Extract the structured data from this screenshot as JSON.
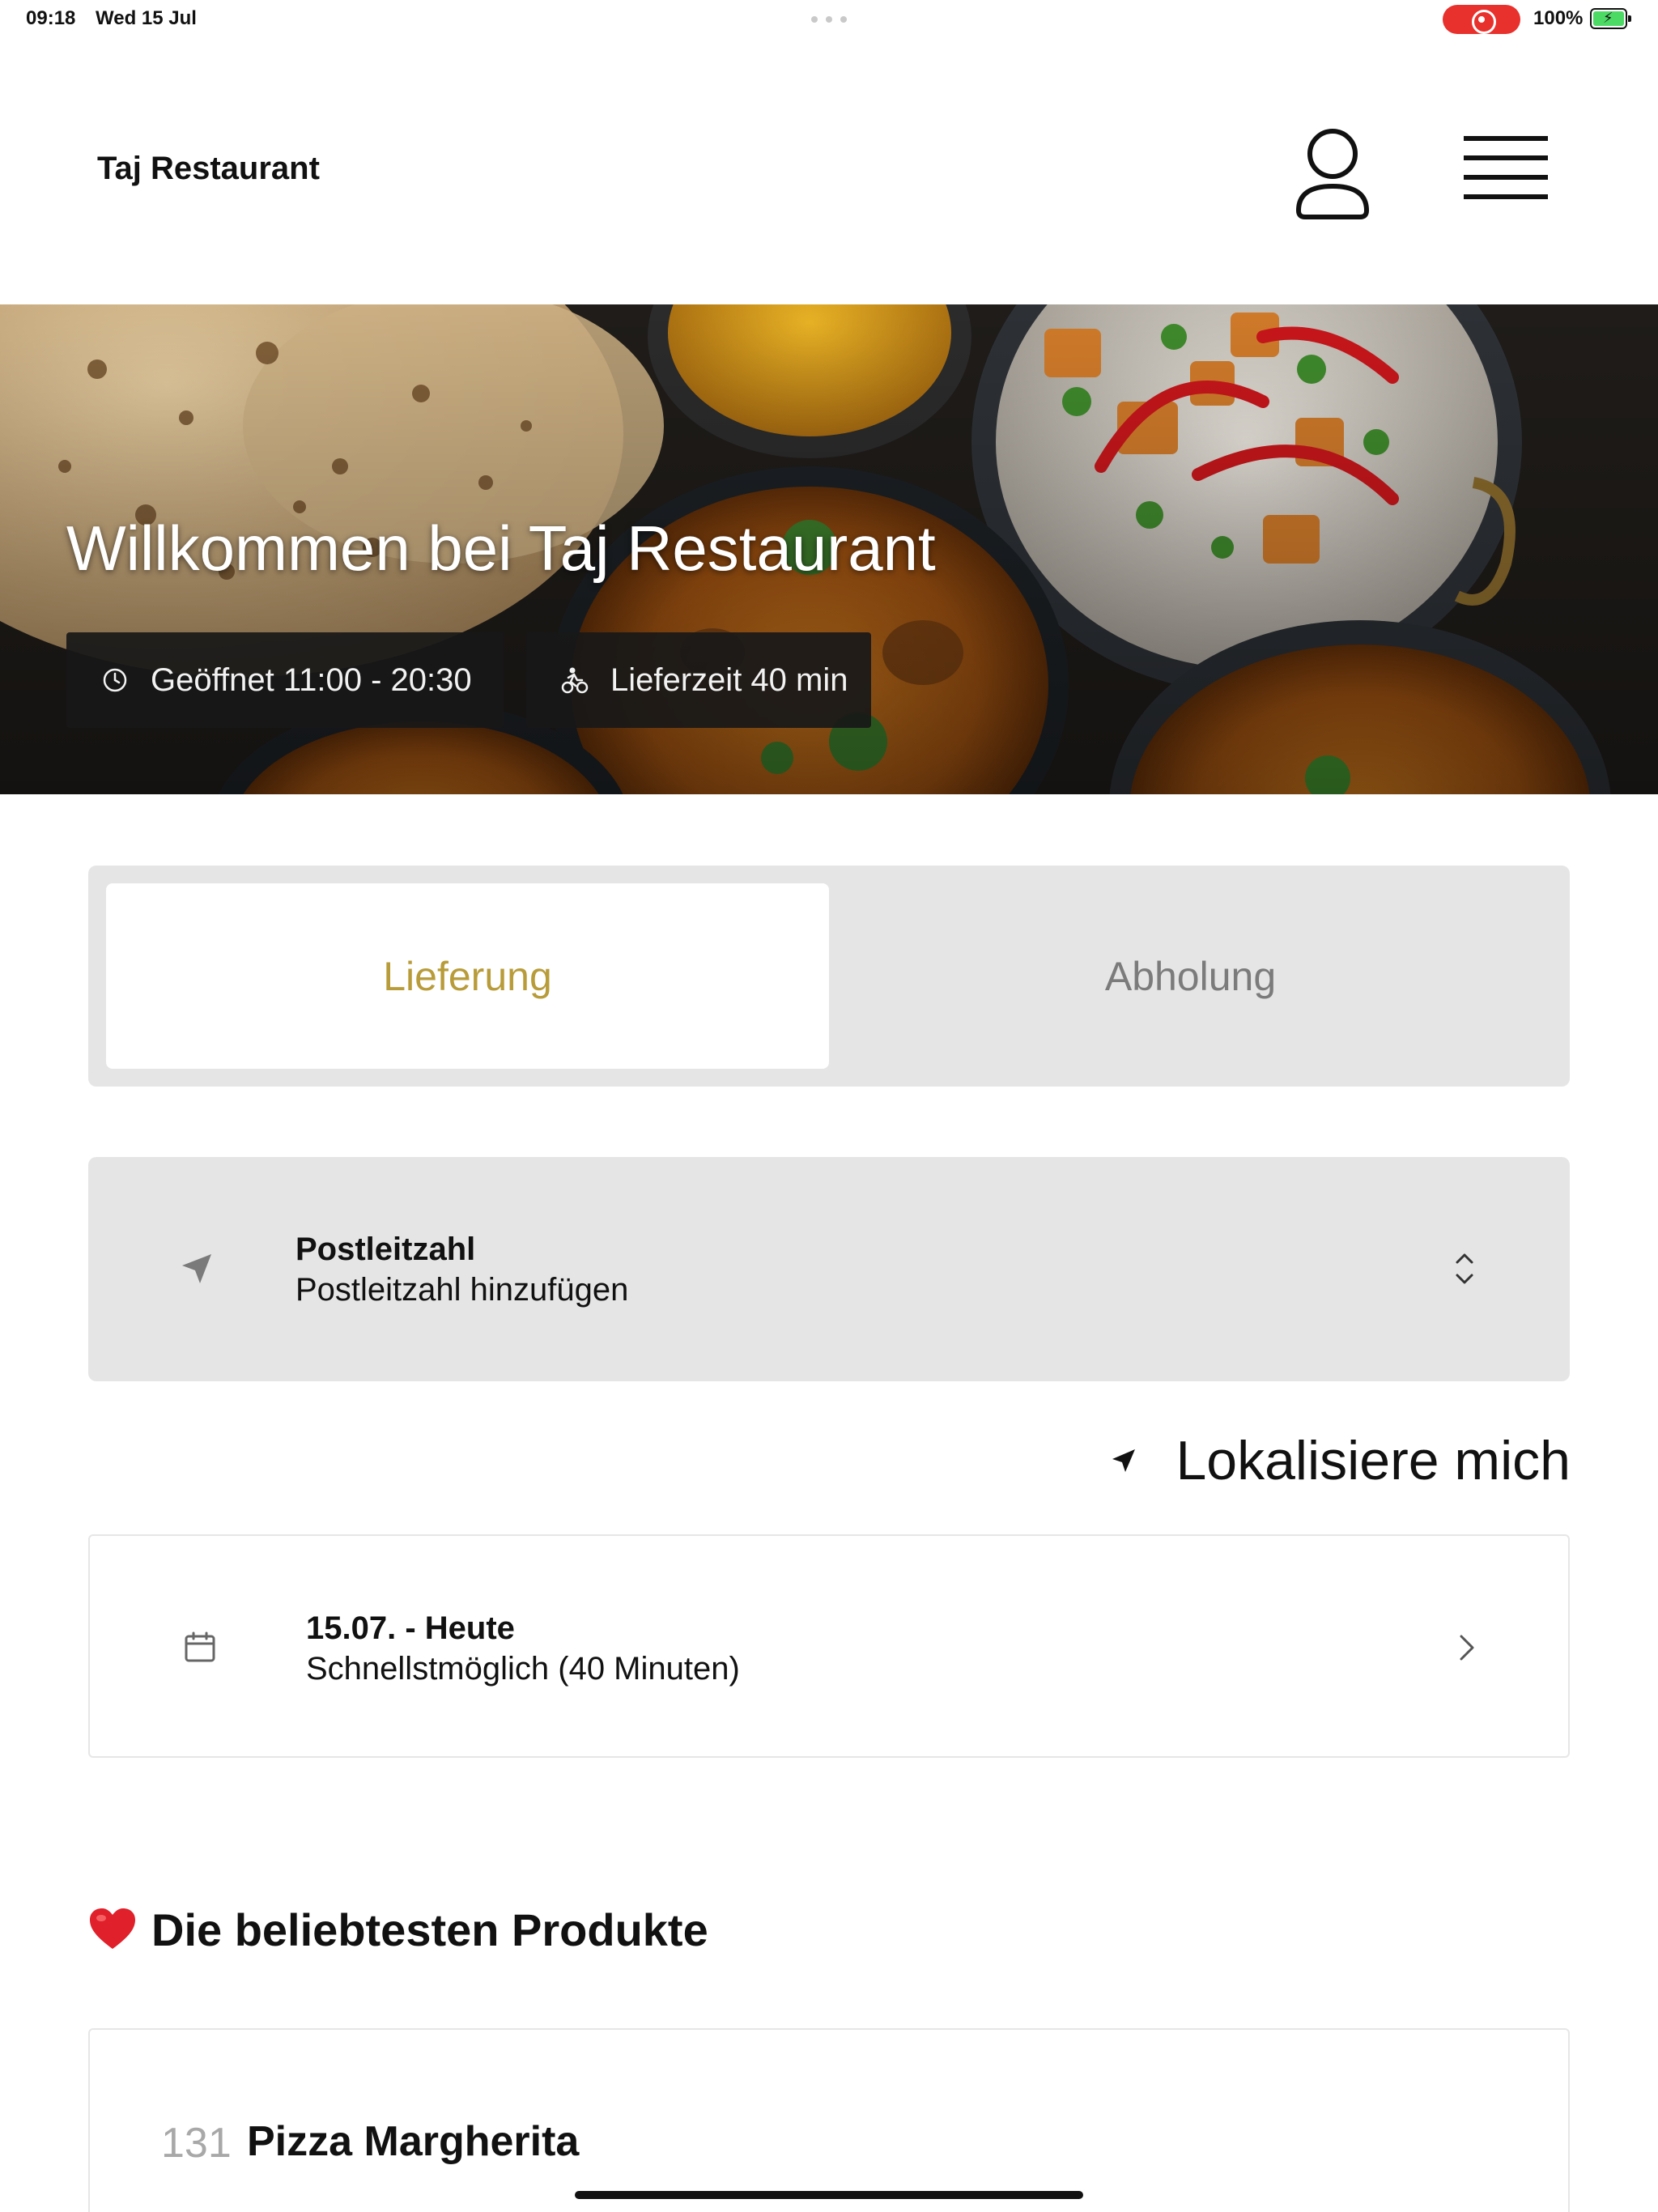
{
  "status_bar": {
    "time": "09:18",
    "date": "Wed 15 Jul",
    "battery_percent": "100%",
    "recording_indicator_color": "#e8302c",
    "battery_fill": 1.0
  },
  "header": {
    "brand": "Taj Restaurant",
    "icons": [
      "user-icon",
      "hamburger-menu-icon"
    ]
  },
  "hero": {
    "title": "Willkommen bei Taj Restaurant",
    "opening_hours": "Geöffnet 11:00 - 20:30",
    "delivery_time": "Lieferzeit 40 min",
    "icons": [
      "clock-icon",
      "bike-courier-icon"
    ]
  },
  "order_mode": {
    "options": [
      "Lieferung",
      "Abholung"
    ],
    "selected": "Lieferung",
    "active_color": "#b89c3a"
  },
  "postcode": {
    "label": "Postleitzahl",
    "placeholder": "Postleitzahl hinzufügen"
  },
  "locate": {
    "label": "Lokalisiere mich"
  },
  "schedule": {
    "date": "15.07. - Heute",
    "time": "Schnellstmöglich (40 Minuten)"
  },
  "popular": {
    "heading": "Die beliebtesten Produkte",
    "products": [
      {
        "number": "131",
        "name": "Pizza Margherita"
      }
    ]
  }
}
